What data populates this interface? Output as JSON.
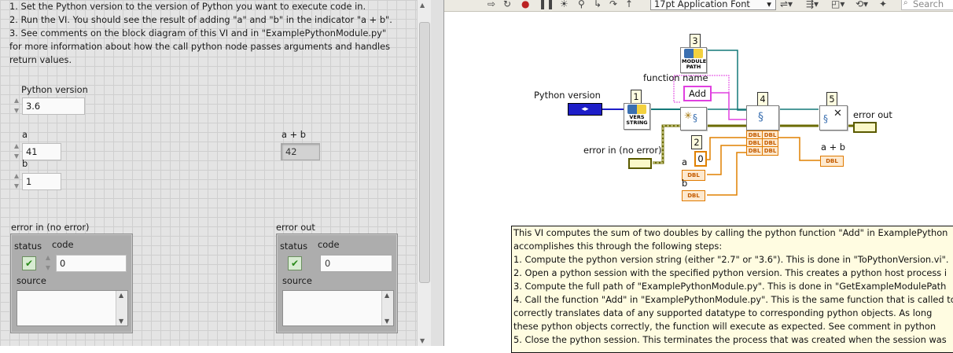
{
  "front_panel": {
    "instructions": [
      "1. Set the Python version to the version of Python you want to execute code in.",
      "2. Run the VI. You should see the result of adding \"a\" and \"b\" in the indicator \"a + b\".",
      "3. See comments on the block diagram of this VI and in \"ExamplePythonModule.py\"",
      "for more information about how the call python node passes arguments and handles",
      "return values."
    ],
    "python_version": {
      "label": "Python version",
      "value": "3.6"
    },
    "a": {
      "label": "a",
      "value": "41"
    },
    "b": {
      "label": "b",
      "value": "1"
    },
    "sum": {
      "label": "a + b",
      "value": "42"
    },
    "error_in": {
      "title": "error in (no error)",
      "status_label": "status",
      "code_label": "code",
      "code_value": "0",
      "source_label": "source",
      "status_glyph": "✔"
    },
    "error_out": {
      "title": "error out",
      "status_label": "status",
      "code_label": "code",
      "code_value": "0",
      "source_label": "source",
      "status_glyph": "✔"
    }
  },
  "toolbar": {
    "font": "17pt Application Font",
    "search_placeholder": "Search",
    "icons": [
      "run-arrow-icon",
      "run-continuously-icon",
      "abort-icon",
      "pause-icon",
      "highlight-execution-icon",
      "retain-wire-values-icon",
      "step-into-icon",
      "step-over-icon",
      "step-out-icon",
      "align-icon",
      "distribute-icon",
      "resize-icon",
      "reorder-icon",
      "clean-up-icon"
    ]
  },
  "diagram": {
    "labels": {
      "python_version": "Python version",
      "function_name": "function name",
      "error_in": "error in (no error)",
      "error_out": "error out",
      "sum": "a + b",
      "a": "a",
      "b": "b"
    },
    "function_const": "Add",
    "zero_const": "0",
    "step_numbers": [
      "1",
      "2",
      "3",
      "4",
      "5"
    ],
    "node_text": {
      "version": "VERS\nSTRING",
      "module": "MODULE\nPATH"
    },
    "dbl": "DBL"
  },
  "comment": [
    "This VI computes the sum of two doubles by calling the python function \"Add\" in ExamplePython",
    " accomplishes this through the following steps:",
    "1. Compute the python version string (either \"2.7\" or \"3.6\"). This is done in \"ToPythonVersion.vi\".",
    "2. Open a python session with the specified python version. This creates a python host process i",
    "3. Compute the full path of \"ExamplePythonModule.py\". This is done in \"GetExampleModulePath",
    "4. Call the function \"Add\" in \"ExamplePythonModule.py\". This is the same function that is called to",
    "    correctly translates data of any supported datatype to corresponding python objects. As long",
    "    these python objects correctly, the function will execute as expected. See comment in python",
    "5. Close the python session. This terminates the process that was created when the session was"
  ],
  "colors": {
    "error_wire": "#6b6b00",
    "string_wire": "#e040e0",
    "refnum_wire": "#147878",
    "dbl_wire": "#e08000",
    "enum_wire": "#1e1ec8"
  }
}
